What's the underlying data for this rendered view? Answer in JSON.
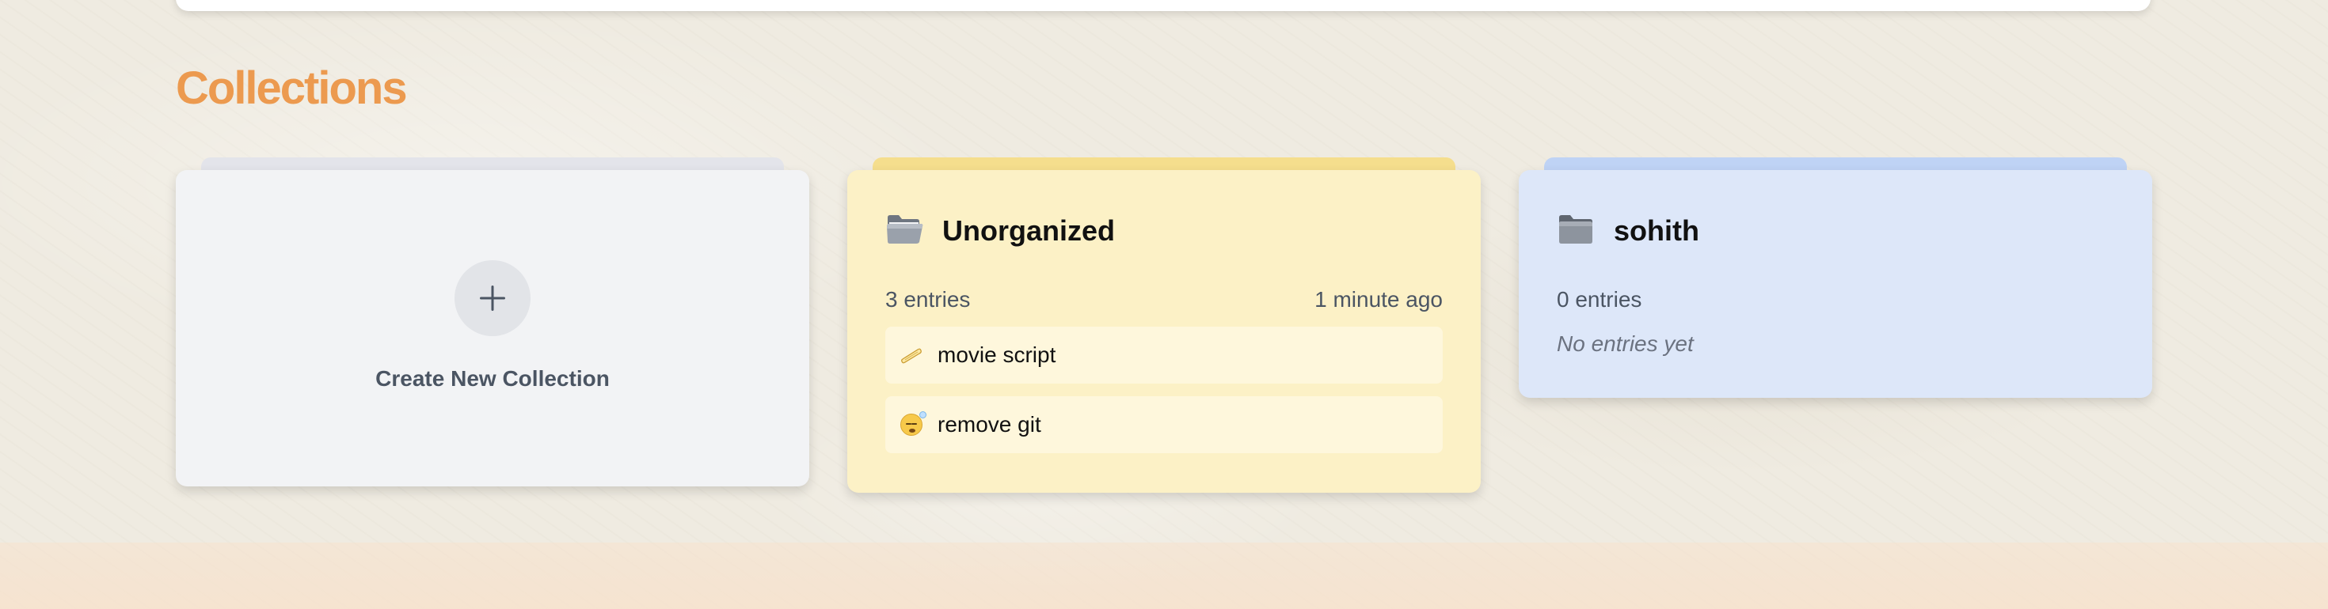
{
  "section": {
    "title": "Collections"
  },
  "create_card": {
    "label": "Create New Collection",
    "icon": "plus-icon"
  },
  "collections": [
    {
      "name": "Unorganized",
      "icon": "open-folder-icon",
      "color": "#fcf1c6",
      "tab_color": "#f5de8d",
      "count": "3 entries",
      "updated": "1 minute ago",
      "entries": [
        {
          "icon": "scroll-icon",
          "title": "movie script"
        },
        {
          "icon": "sleeping-face-icon",
          "title": "remove git"
        }
      ]
    },
    {
      "name": "sohith",
      "icon": "folder-icon",
      "color": "#dde7f9",
      "tab_color": "#bfd3f5",
      "count": "0 entries",
      "empty_message": "No entries yet"
    }
  ],
  "colors": {
    "title_accent": "#ec9a4f"
  }
}
